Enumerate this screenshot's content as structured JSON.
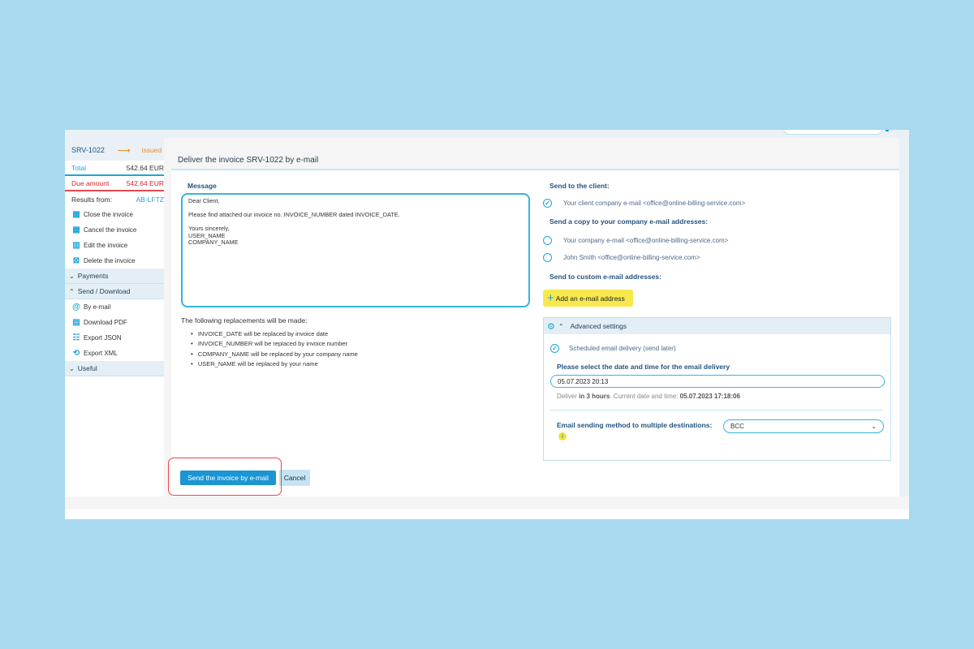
{
  "sidebar": {
    "invoice_code": "SRV-1022",
    "status_arrow": "⟶",
    "status": "issued",
    "total_label": "Total",
    "total_value": "542.64 EUR",
    "due_label": "Due amount",
    "due_value": "542.64 EUR",
    "results_label": "Results from:",
    "results_value": "AB-LFTZ",
    "actions": [
      {
        "label": "Close the invoice",
        "icon": "close-invoice-icon"
      },
      {
        "label": "Cancel the invoice",
        "icon": "cancel-invoice-icon"
      },
      {
        "label": "Edit the invoice",
        "icon": "edit-invoice-icon"
      },
      {
        "label": "Delete the invoice",
        "icon": "delete-invoice-icon"
      }
    ],
    "sections": {
      "payments": {
        "label": "Payments",
        "chevron": "⌄"
      },
      "send_download": {
        "label": "Send / Download",
        "chevron": "⌃"
      },
      "useful": {
        "label": "Useful",
        "chevron": "⌄"
      }
    },
    "send_items": [
      {
        "label": "By e-mail",
        "icon": "at-icon",
        "glyph": "@"
      },
      {
        "label": "Download PDF",
        "icon": "pdf-icon",
        "glyph": "▤"
      },
      {
        "label": "Export JSON",
        "icon": "json-icon",
        "glyph": "☷"
      },
      {
        "label": "Export XML",
        "icon": "xml-icon",
        "glyph": "⟲"
      }
    ]
  },
  "main": {
    "title": "Deliver the invoice SRV-1022 by e-mail",
    "message_label": "Message",
    "message_text": "Dear Client,\n\nPlease find attached our invoice no. INVOICE_NUMBER dated INVOICE_DATE.\n\nYours sincerely,\nUSER_NAME\nCOMPANY_NAME",
    "replacements_heading": "The following replacements will be made:",
    "replacements": [
      "INVOICE_DATE will be replaced by invoice date",
      "INVOICE_NUMBER will be replaced by invoice number",
      "COMPANY_NAME will be replaced by your company name",
      "USER_NAME will be replaced by your name"
    ],
    "send_to_client_label": "Send to the client:",
    "client_option": {
      "label": "Your client company e-mail <office@online-billing-service.com>",
      "checked": true
    },
    "copy_label": "Send a copy to your company e-mail addresses:",
    "copy_options": [
      {
        "label": "Your company e-mail <office@online-billing-service.com>",
        "checked": false
      },
      {
        "label": "John Smith <office@online-billing-service.com>",
        "checked": false
      }
    ],
    "custom_label": "Send to custom e-mail addresses:",
    "add_email_label": "Add an e-mail address",
    "advanced": {
      "title": "Advanced settings",
      "scheduled_label": "Scheduled email delivery (send later)",
      "scheduled_checked": true,
      "datetime_label": "Please select the date and time for the email delivery",
      "datetime_value": "05.07.2023 20:13",
      "deliver_prefix": "Deliver ",
      "deliver_in": "in 3 hours",
      "deliver_mid": ". Current date and time: ",
      "current_datetime": "05.07.2023 17:18:06",
      "method_label": "Email sending method to multiple destinations:",
      "method_value": "BCC"
    },
    "send_button": "Send the invoice by e-mail",
    "cancel_button": "Cancel"
  },
  "colors": {
    "accent": "#1ca6d9",
    "primary_button": "#1b95d3",
    "status_orange": "#f08a2c",
    "due_red": "#d3262f",
    "add_button_yellow": "#f7e84d",
    "highlight_red": "#e6474f",
    "background": "#a8d9ee"
  }
}
